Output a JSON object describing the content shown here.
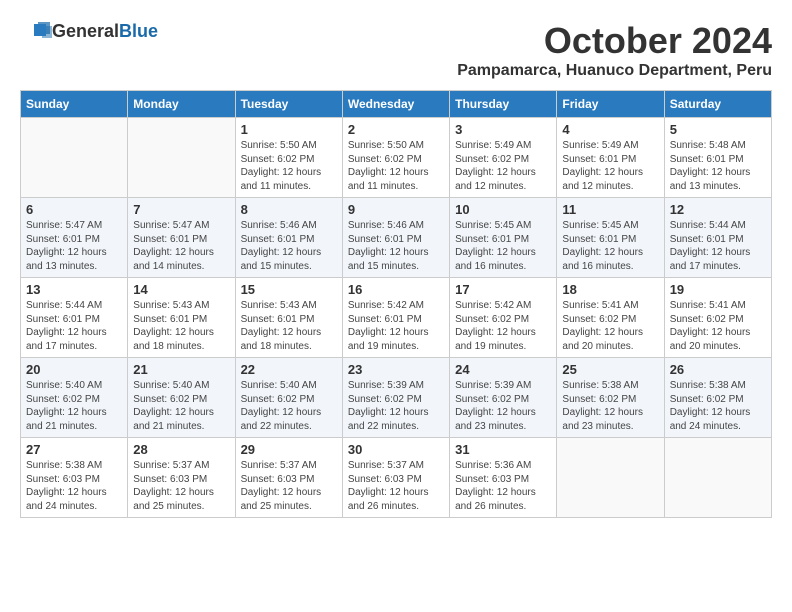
{
  "header": {
    "logo_general": "General",
    "logo_blue": "Blue",
    "month": "October 2024",
    "location": "Pampamarca, Huanuco Department, Peru"
  },
  "weekdays": [
    "Sunday",
    "Monday",
    "Tuesday",
    "Wednesday",
    "Thursday",
    "Friday",
    "Saturday"
  ],
  "weeks": [
    [
      {
        "day": "",
        "info": ""
      },
      {
        "day": "",
        "info": ""
      },
      {
        "day": "1",
        "info": "Sunrise: 5:50 AM\nSunset: 6:02 PM\nDaylight: 12 hours\nand 11 minutes."
      },
      {
        "day": "2",
        "info": "Sunrise: 5:50 AM\nSunset: 6:02 PM\nDaylight: 12 hours\nand 11 minutes."
      },
      {
        "day": "3",
        "info": "Sunrise: 5:49 AM\nSunset: 6:02 PM\nDaylight: 12 hours\nand 12 minutes."
      },
      {
        "day": "4",
        "info": "Sunrise: 5:49 AM\nSunset: 6:01 PM\nDaylight: 12 hours\nand 12 minutes."
      },
      {
        "day": "5",
        "info": "Sunrise: 5:48 AM\nSunset: 6:01 PM\nDaylight: 12 hours\nand 13 minutes."
      }
    ],
    [
      {
        "day": "6",
        "info": "Sunrise: 5:47 AM\nSunset: 6:01 PM\nDaylight: 12 hours\nand 13 minutes."
      },
      {
        "day": "7",
        "info": "Sunrise: 5:47 AM\nSunset: 6:01 PM\nDaylight: 12 hours\nand 14 minutes."
      },
      {
        "day": "8",
        "info": "Sunrise: 5:46 AM\nSunset: 6:01 PM\nDaylight: 12 hours\nand 15 minutes."
      },
      {
        "day": "9",
        "info": "Sunrise: 5:46 AM\nSunset: 6:01 PM\nDaylight: 12 hours\nand 15 minutes."
      },
      {
        "day": "10",
        "info": "Sunrise: 5:45 AM\nSunset: 6:01 PM\nDaylight: 12 hours\nand 16 minutes."
      },
      {
        "day": "11",
        "info": "Sunrise: 5:45 AM\nSunset: 6:01 PM\nDaylight: 12 hours\nand 16 minutes."
      },
      {
        "day": "12",
        "info": "Sunrise: 5:44 AM\nSunset: 6:01 PM\nDaylight: 12 hours\nand 17 minutes."
      }
    ],
    [
      {
        "day": "13",
        "info": "Sunrise: 5:44 AM\nSunset: 6:01 PM\nDaylight: 12 hours\nand 17 minutes."
      },
      {
        "day": "14",
        "info": "Sunrise: 5:43 AM\nSunset: 6:01 PM\nDaylight: 12 hours\nand 18 minutes."
      },
      {
        "day": "15",
        "info": "Sunrise: 5:43 AM\nSunset: 6:01 PM\nDaylight: 12 hours\nand 18 minutes."
      },
      {
        "day": "16",
        "info": "Sunrise: 5:42 AM\nSunset: 6:01 PM\nDaylight: 12 hours\nand 19 minutes."
      },
      {
        "day": "17",
        "info": "Sunrise: 5:42 AM\nSunset: 6:02 PM\nDaylight: 12 hours\nand 19 minutes."
      },
      {
        "day": "18",
        "info": "Sunrise: 5:41 AM\nSunset: 6:02 PM\nDaylight: 12 hours\nand 20 minutes."
      },
      {
        "day": "19",
        "info": "Sunrise: 5:41 AM\nSunset: 6:02 PM\nDaylight: 12 hours\nand 20 minutes."
      }
    ],
    [
      {
        "day": "20",
        "info": "Sunrise: 5:40 AM\nSunset: 6:02 PM\nDaylight: 12 hours\nand 21 minutes."
      },
      {
        "day": "21",
        "info": "Sunrise: 5:40 AM\nSunset: 6:02 PM\nDaylight: 12 hours\nand 21 minutes."
      },
      {
        "day": "22",
        "info": "Sunrise: 5:40 AM\nSunset: 6:02 PM\nDaylight: 12 hours\nand 22 minutes."
      },
      {
        "day": "23",
        "info": "Sunrise: 5:39 AM\nSunset: 6:02 PM\nDaylight: 12 hours\nand 22 minutes."
      },
      {
        "day": "24",
        "info": "Sunrise: 5:39 AM\nSunset: 6:02 PM\nDaylight: 12 hours\nand 23 minutes."
      },
      {
        "day": "25",
        "info": "Sunrise: 5:38 AM\nSunset: 6:02 PM\nDaylight: 12 hours\nand 23 minutes."
      },
      {
        "day": "26",
        "info": "Sunrise: 5:38 AM\nSunset: 6:02 PM\nDaylight: 12 hours\nand 24 minutes."
      }
    ],
    [
      {
        "day": "27",
        "info": "Sunrise: 5:38 AM\nSunset: 6:03 PM\nDaylight: 12 hours\nand 24 minutes."
      },
      {
        "day": "28",
        "info": "Sunrise: 5:37 AM\nSunset: 6:03 PM\nDaylight: 12 hours\nand 25 minutes."
      },
      {
        "day": "29",
        "info": "Sunrise: 5:37 AM\nSunset: 6:03 PM\nDaylight: 12 hours\nand 25 minutes."
      },
      {
        "day": "30",
        "info": "Sunrise: 5:37 AM\nSunset: 6:03 PM\nDaylight: 12 hours\nand 26 minutes."
      },
      {
        "day": "31",
        "info": "Sunrise: 5:36 AM\nSunset: 6:03 PM\nDaylight: 12 hours\nand 26 minutes."
      },
      {
        "day": "",
        "info": ""
      },
      {
        "day": "",
        "info": ""
      }
    ]
  ]
}
